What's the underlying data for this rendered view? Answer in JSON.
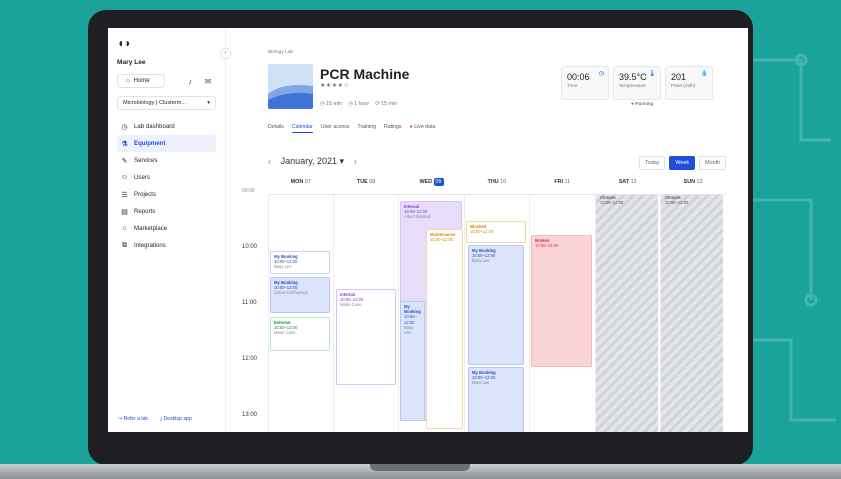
{
  "app": {
    "user_name": "Mary Lee",
    "home_label": "Home",
    "org_select": "Microbiology | Clusterm...",
    "nav": [
      {
        "label": "Lab dashboard",
        "icon": "dashboard-icon"
      },
      {
        "label": "Equipment",
        "icon": "equipment-icon",
        "active": true
      },
      {
        "label": "Services",
        "icon": "services-icon"
      },
      {
        "label": "Users",
        "icon": "users-icon"
      },
      {
        "label": "Projects",
        "icon": "projects-icon"
      },
      {
        "label": "Reports",
        "icon": "reports-icon"
      },
      {
        "label": "Marketplace",
        "icon": "marketplace-icon"
      },
      {
        "label": "Integrations",
        "icon": "integrations-icon"
      }
    ],
    "footer": {
      "refer": "Refer a lab",
      "desktop": "Desktop app"
    }
  },
  "equipment": {
    "breadcrumb": "Biology Lab",
    "title": "PCR Machine",
    "rating_stars": "★★★★☆",
    "durations": [
      "15 min",
      "1 hour",
      "15 min"
    ],
    "tabs": [
      "Details",
      "Calendar",
      "User access",
      "Training",
      "Ratings",
      "Live data"
    ],
    "active_tab": "Calendar",
    "stats": [
      {
        "value": "00:06",
        "label": "Time",
        "icon": "clock-icon"
      },
      {
        "value": "39.5°C",
        "label": "Temperature",
        "icon": "thermometer-icon"
      },
      {
        "value": "201",
        "label": "Feed (ml/h)",
        "icon": "drop-icon"
      }
    ],
    "status": "Running"
  },
  "calendar": {
    "month_label": "January, 2021",
    "views": [
      "Today",
      "Week",
      "Month"
    ],
    "active_view": "Week",
    "days": [
      {
        "name": "MON",
        "num": "07"
      },
      {
        "name": "TUE",
        "num": "08"
      },
      {
        "name": "WED",
        "num": "09",
        "today": true
      },
      {
        "name": "THU",
        "num": "10"
      },
      {
        "name": "FRI",
        "num": "11"
      },
      {
        "name": "SAT",
        "num": "12"
      },
      {
        "name": "SUN",
        "num": "13"
      }
    ],
    "hours": [
      "09:00",
      "10:00",
      "11:00",
      "12:00",
      "13:00"
    ],
    "events": [
      {
        "title": "My Booking",
        "time": "10:00–12:00",
        "who": "Mary Lee"
      },
      {
        "title": "My Booking",
        "time": "10:00–12:00",
        "who": "Simon Kimheeson"
      },
      {
        "title": "External",
        "time": "10:00–12:00",
        "who": "Marie Curie"
      },
      {
        "title": "Internal",
        "time": "10:00–12:00",
        "who": "Marie Curie"
      },
      {
        "title": "Internal",
        "time": "10:00–12:00",
        "who": "Albert Einstein"
      },
      {
        "title": "Maintenance",
        "time": "10:00–12:00",
        "who": ""
      },
      {
        "title": "My Booking",
        "time": "10:00–12:00",
        "who": "Mary Lee"
      },
      {
        "title": "Blocked",
        "time": "10:00–12:00",
        "who": ""
      },
      {
        "title": "My Booking",
        "time": "10:00–12:00",
        "who": "Mary Lee"
      },
      {
        "title": "My Booking",
        "time": "10:00–12:00",
        "who": "Mary Lee"
      },
      {
        "title": "Broken",
        "time": "10:00–12:00",
        "who": ""
      },
      {
        "title": "Closure",
        "time": "10:00–12:00",
        "who": ""
      },
      {
        "title": "Closure",
        "time": "10:00–12:00",
        "who": ""
      }
    ]
  }
}
